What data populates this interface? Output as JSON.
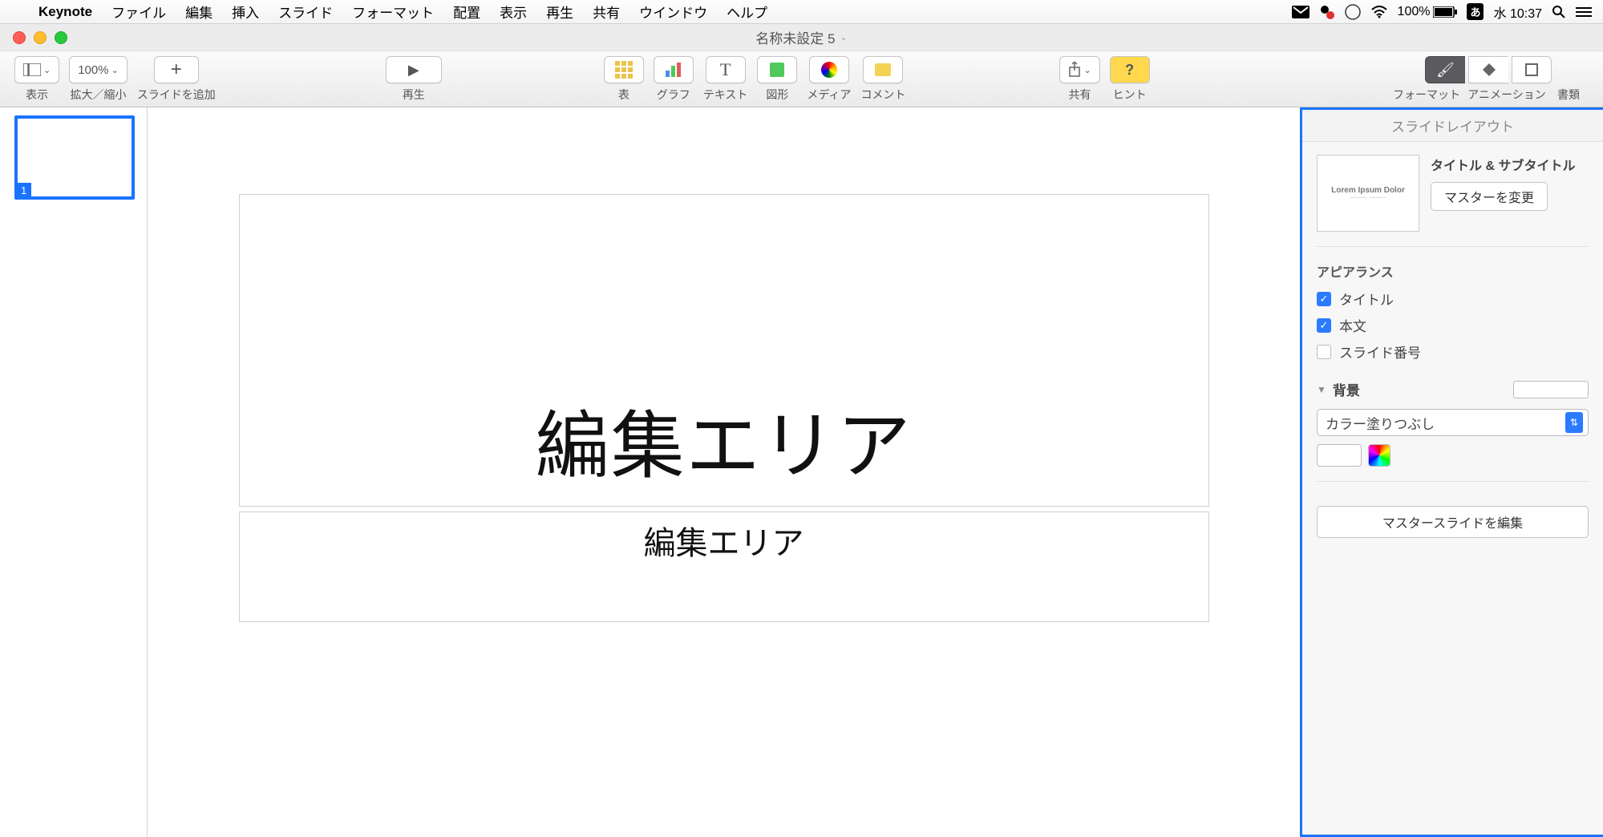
{
  "menubar": {
    "appname": "Keynote",
    "items": [
      "ファイル",
      "編集",
      "挿入",
      "スライド",
      "フォーマット",
      "配置",
      "表示",
      "再生",
      "共有",
      "ウインドウ",
      "ヘルプ"
    ],
    "battery": "100%",
    "input_mode": "あ",
    "day": "水",
    "clock": "10:37"
  },
  "window": {
    "title": "名称未設定 5"
  },
  "toolbar": {
    "view": "表示",
    "zoom_value": "100%",
    "zoom_label": "拡大／縮小",
    "add_slide": "スライドを追加",
    "play": "再生",
    "table": "表",
    "chart": "グラフ",
    "text": "テキスト",
    "shape": "図形",
    "media": "メディア",
    "comment": "コメント",
    "share": "共有",
    "hint": "ヒント",
    "format": "フォーマット",
    "animation": "アニメーション",
    "document": "書類"
  },
  "thumb": {
    "num": "1"
  },
  "slide": {
    "title": "編集エリア",
    "subtitle": "編集エリア"
  },
  "panel": {
    "header": "スライドレイアウト",
    "thumb_line1": "Lorem Ipsum Dolor",
    "layout_name": "タイトル & サブタイトル",
    "change_master": "マスターを変更",
    "appearance": "アピアランス",
    "chk_title": "タイトル",
    "chk_body": "本文",
    "chk_slidenum": "スライド番号",
    "background": "背景",
    "fill_type": "カラー塗りつぶし",
    "edit_master": "マスタースライドを編集"
  }
}
